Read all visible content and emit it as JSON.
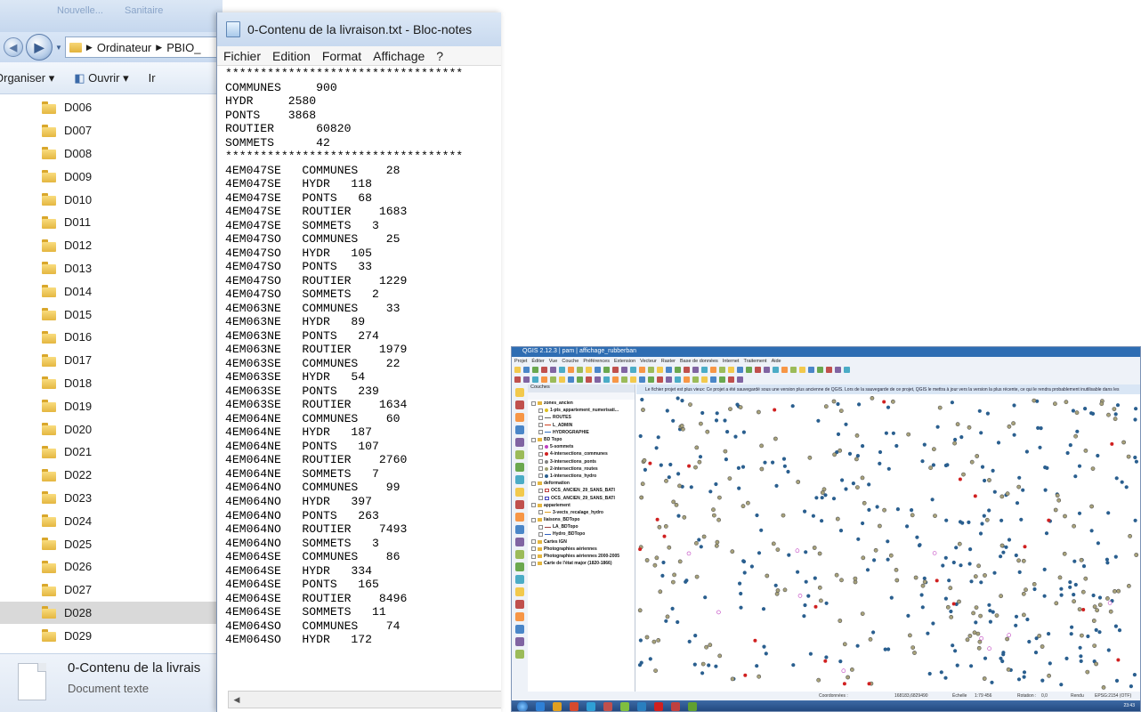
{
  "explorer": {
    "ghost_labels": [
      "Nouvelle...",
      "Sanitaire"
    ],
    "breadcrumb": [
      "Ordinateur",
      "PBIO_"
    ],
    "toolbar": {
      "organize": "Organiser ▾",
      "open": "Ouvrir ▾",
      "extra": "Ir"
    },
    "folders": [
      "D006",
      "D007",
      "D008",
      "D009",
      "D010",
      "D011",
      "D012",
      "D013",
      "D014",
      "D015",
      "D016",
      "D017",
      "D018",
      "D019",
      "D020",
      "D021",
      "D022",
      "D023",
      "D024",
      "D025",
      "D026",
      "D027",
      "D028",
      "D029"
    ],
    "selected_folder": "D028",
    "details": {
      "name": "0-Contenu de la livrais",
      "type": "Document texte"
    }
  },
  "notepad": {
    "title": "0-Contenu de la livraison.txt - Bloc-notes",
    "menu": [
      "Fichier",
      "Edition",
      "Format",
      "Affichage",
      "?"
    ],
    "lines": [
      "**********************************",
      "COMMUNES     900",
      "HYDR     2580",
      "PONTS    3868",
      "ROUTIER      60820",
      "SOMMETS      42",
      "**********************************",
      "4EM047SE   COMMUNES    28",
      "4EM047SE   HYDR   118",
      "4EM047SE   PONTS   68",
      "4EM047SE   ROUTIER    1683",
      "4EM047SE   SOMMETS   3",
      "4EM047SO   COMMUNES    25",
      "4EM047SO   HYDR   105",
      "4EM047SO   PONTS   33",
      "4EM047SO   ROUTIER    1229",
      "4EM047SO   SOMMETS   2",
      "4EM063NE   COMMUNES    33",
      "4EM063NE   HYDR   89",
      "4EM063NE   PONTS   274",
      "4EM063NE   ROUTIER    1979",
      "4EM063SE   COMMUNES    22",
      "4EM063SE   HYDR   54",
      "4EM063SE   PONTS   239",
      "4EM063SE   ROUTIER    1634",
      "4EM064NE   COMMUNES    60",
      "4EM064NE   HYDR   187",
      "4EM064NE   PONTS   107",
      "4EM064NE   ROUTIER    2760",
      "4EM064NE   SOMMETS   7",
      "4EM064NO   COMMUNES    99",
      "4EM064NO   HYDR   397",
      "4EM064NO   PONTS   263",
      "4EM064NO   ROUTIER    7493",
      "4EM064NO   SOMMETS   3",
      "4EM064SE   COMMUNES    86",
      "4EM064SE   HYDR   334",
      "4EM064SE   PONTS   165",
      "4EM064SE   ROUTIER    8496",
      "4EM064SE   SOMMETS   11",
      "4EM064SO   COMMUNES    74",
      "4EM064SO   HYDR   172"
    ]
  },
  "qgis": {
    "title": "QGIS 2.12.3 | pam | affichage_rubberban",
    "menu": [
      "Projet",
      "Éditer",
      "Vue",
      "Couche",
      "Préférences",
      "Extension",
      "Vecteur",
      "Raster",
      "Base de données",
      "Internet",
      "Traitement",
      "Aide"
    ],
    "layers_title": "Couches",
    "layers": [
      {
        "label": "zones_ancien",
        "kind": "group"
      },
      {
        "label": "1-pts_appartement_numerisati...",
        "kind": "point",
        "color": "#e0c020"
      },
      {
        "label": "ROUTES",
        "kind": "line",
        "color": "#666666"
      },
      {
        "label": "L_ADMIN",
        "kind": "line",
        "color": "#d04020"
      },
      {
        "label": "HYDROGRAPHIE",
        "kind": "line",
        "color": "#3070c0"
      },
      {
        "label": "BD Topo",
        "kind": "group"
      },
      {
        "label": "5-sommets",
        "kind": "point",
        "color": "#c040c0"
      },
      {
        "label": "4-intersections_communes",
        "kind": "point",
        "color": "#d02020"
      },
      {
        "label": "3-intersections_ponts",
        "kind": "point",
        "color": "#808080"
      },
      {
        "label": "2-intersections_routes",
        "kind": "point",
        "color": "#a0a070"
      },
      {
        "label": "1-intersections_hydro",
        "kind": "point",
        "color": "#2a5f8f"
      },
      {
        "label": "deformation",
        "kind": "group"
      },
      {
        "label": "OCS_ANCIEN_29_SANS_BATI",
        "kind": "poly",
        "color": "#c04040"
      },
      {
        "label": "OCS_ANCIEN_29_SANS_BATI",
        "kind": "poly",
        "color": "#4040c0"
      },
      {
        "label": "appariement",
        "kind": "group"
      },
      {
        "label": "3-vects_recalage_hydro",
        "kind": "line",
        "color": "#e0a020"
      },
      {
        "label": "liaisons_BDTopo",
        "kind": "group"
      },
      {
        "label": "LA_BDTopo",
        "kind": "line",
        "color": "#a04040"
      },
      {
        "label": "Hydro_BDTopo",
        "kind": "line",
        "color": "#3060c0"
      },
      {
        "label": "Cartes IGN",
        "kind": "group"
      },
      {
        "label": "Photographies aériennes",
        "kind": "group"
      },
      {
        "label": "Photographies aériennes 2000-2005",
        "kind": "group"
      },
      {
        "label": "Carte de l'état major (1820-1866)",
        "kind": "group"
      }
    ],
    "message": "Le fichier projet est plus vieux: Ce projet a été sauvegardé sous une version plus ancienne de QGIS. Lors de la sauvegarde de ce projet, QGIS le mettra à jour vers la version la plus récente, ce qui le rendra probablement inutilisable dans les",
    "status": {
      "coord_label": "Coordonnées :",
      "coord_value": "168183,6829490",
      "scale_label": "Échelle",
      "scale_value": "1:79 456",
      "rotation_label": "Rotation :",
      "rotation_value": "0,0",
      "render_label": "Rendu",
      "crs": "EPSG:2154 (OTF)"
    },
    "clock": "23:43",
    "map_colors": {
      "hydro": "#2a5f8f",
      "routes": "#a8a27a",
      "communes": "#d02020",
      "sommets": "#c040c0"
    }
  }
}
